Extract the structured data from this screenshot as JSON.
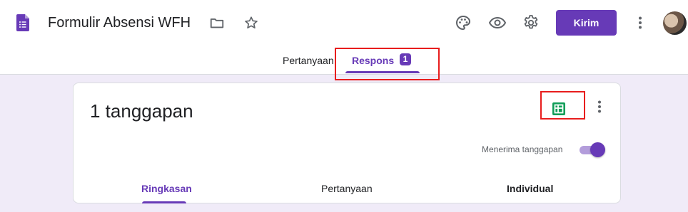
{
  "header": {
    "title": "Formulir Absensi WFH",
    "send_label": "Kirim",
    "icons": [
      "forms-logo-icon",
      "folder-icon",
      "star-icon",
      "palette-icon",
      "eye-icon",
      "gear-icon",
      "more-vert-icon"
    ]
  },
  "tabs": {
    "questions_label": "Pertanyaan",
    "responses_label": "Respons",
    "responses_count": "1"
  },
  "card": {
    "response_count_text": "1 tanggapan",
    "accepting_label": "Menerima tanggapan",
    "accepting_responses": true,
    "subtabs": {
      "summary": "Ringkasan",
      "questions": "Pertanyaan",
      "individual": "Individual"
    }
  },
  "colors": {
    "accent": "#673ab7",
    "background": "#f0ebf8",
    "sheets_green": "#0f9d58",
    "highlight_red": "#e81d1d"
  }
}
